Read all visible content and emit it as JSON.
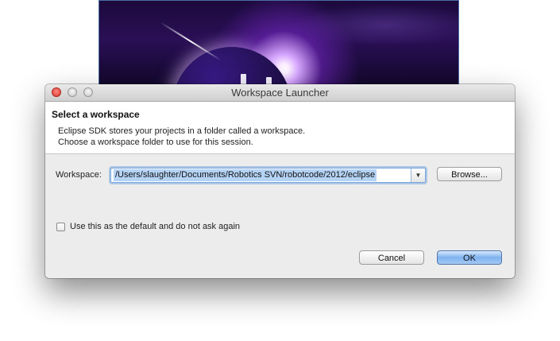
{
  "window": {
    "title": "Workspace Launcher"
  },
  "banner": {
    "heading": "Select a workspace",
    "line1": "Eclipse SDK stores your projects in a folder called a workspace.",
    "line2": "Choose a workspace folder to use for this session."
  },
  "workspace": {
    "label": "Workspace:",
    "value": "/Users/slaughter/Documents/Robotics SVN/robotcode/2012/eclipse",
    "dropdown_glyph": "▼",
    "browse_label": "Browse..."
  },
  "options": {
    "default_label": "Use this as the default and do not ask again",
    "default_checked": false
  },
  "actions": {
    "cancel_label": "Cancel",
    "ok_label": "OK"
  },
  "colors": {
    "accent": "#7aa7df",
    "close_button": "#d8342b"
  }
}
